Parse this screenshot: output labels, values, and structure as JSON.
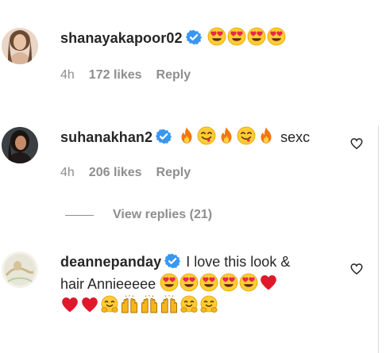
{
  "comments": [
    {
      "username": "shanayakapoor02",
      "emoji_icons": [
        "heart-eyes-emoji",
        "heart-eyes-emoji",
        "heart-eyes-emoji",
        "heart-eyes-emoji"
      ],
      "time": "4h",
      "likes": "172 likes",
      "reply": "Reply"
    },
    {
      "username": "suhanakhan2",
      "emoji_icons": [
        "fire-emoji",
        "savoring-face-emoji",
        "fire-emoji",
        "savoring-face-emoji",
        "fire-emoji"
      ],
      "text": "sexc",
      "time": "4h",
      "likes": "206 likes",
      "reply": "Reply",
      "view_replies": "View replies (21)"
    },
    {
      "username": "deannepanday",
      "text_line1": "I love this look &",
      "text_line2": "hair Annieeeee",
      "emoji_icons_line2": [
        "heart-eyes-emoji",
        "heart-eyes-emoji",
        "heart-eyes-emoji",
        "heart-eyes-emoji",
        "heart-eyes-emoji",
        "red-heart-emoji"
      ],
      "emoji_icons_line3": [
        "red-heart-emoji",
        "red-heart-emoji",
        "hugging-face-emoji",
        "raising-hands-emoji",
        "raising-hands-emoji",
        "raising-hands-emoji",
        "hugging-face-emoji",
        "hugging-face-emoji"
      ]
    }
  ],
  "colors": {
    "text": "#262626",
    "secondary": "#8e8e8e",
    "verified": "#3897f0",
    "border": "#dbdbdb"
  }
}
